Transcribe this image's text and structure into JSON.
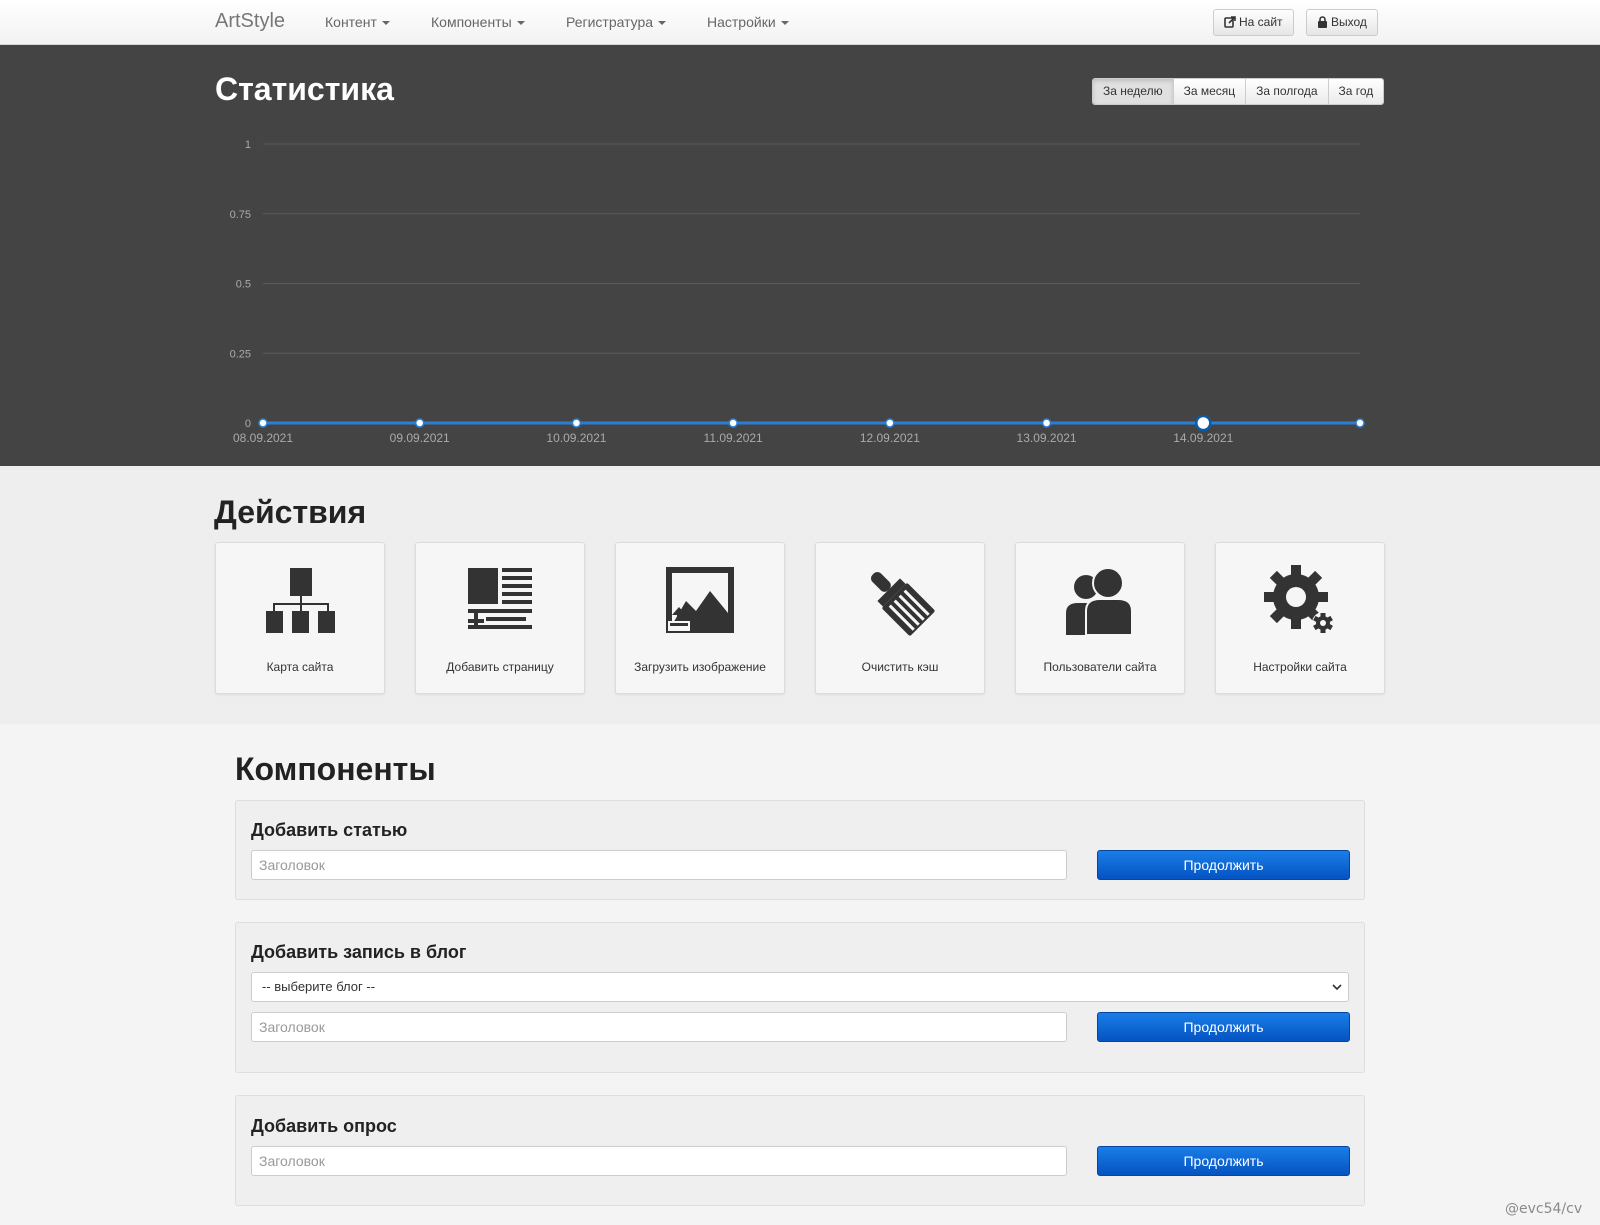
{
  "navbar": {
    "brand": "ArtStyle",
    "menu": [
      {
        "label": "Контент"
      },
      {
        "label": "Компоненты"
      },
      {
        "label": "Регистратура"
      },
      {
        "label": "Настройки"
      }
    ],
    "site_button": {
      "label": "На сайт",
      "icon": "external-link-icon"
    },
    "logout_button": {
      "label": "Выход",
      "icon": "lock-icon"
    }
  },
  "stats": {
    "title": "Статистика",
    "periods": [
      {
        "label": "За неделю",
        "active": true
      },
      {
        "label": "За месяц",
        "active": false
      },
      {
        "label": "За полгода",
        "active": false
      },
      {
        "label": "За год",
        "active": false
      }
    ]
  },
  "chart_data": {
    "type": "line",
    "x": [
      "08.09.2021",
      "09.09.2021",
      "10.09.2021",
      "11.09.2021",
      "12.09.2021",
      "13.09.2021",
      "14.09.2021",
      ""
    ],
    "series": [
      {
        "values": [
          0,
          0,
          0,
          0,
          0,
          0,
          0,
          0
        ]
      }
    ],
    "ylim": [
      0,
      1
    ],
    "yticks": [
      "1",
      "0.75",
      "0.5",
      "0.25",
      "0"
    ],
    "yticks_values": [
      1,
      0.75,
      0.5,
      0.25,
      0
    ],
    "highlighted_index": 6,
    "grid": true,
    "colors": {
      "line": "#2a7fd4",
      "grid": "#5a5a5a",
      "tick": "#aaaaaa",
      "point_fill": "#ffffff"
    }
  },
  "actions": {
    "title": "Действия",
    "items": [
      {
        "label": "Карта сайта",
        "icon": "sitemap-icon"
      },
      {
        "label": "Добавить страницу",
        "icon": "add-page-icon"
      },
      {
        "label": "Загрузить изображение",
        "icon": "upload-image-icon"
      },
      {
        "label": "Очистить кэш",
        "icon": "brush-icon"
      },
      {
        "label": "Пользователи сайта",
        "icon": "users-icon"
      },
      {
        "label": "Настройки сайта",
        "icon": "gear-icon"
      }
    ]
  },
  "components": {
    "title": "Компоненты",
    "article": {
      "title": "Добавить статью",
      "placeholder": "Заголовок",
      "button": "Продолжить"
    },
    "blog": {
      "title": "Добавить запись в блог",
      "select_value": "-- выберите блог --",
      "placeholder": "Заголовок",
      "button": "Продолжить"
    },
    "poll": {
      "title": "Добавить опрос",
      "placeholder": "Заголовок",
      "button": "Продолжить"
    }
  },
  "watermark": "@evc54/cv",
  "colors": {
    "accent": "#0a66d6",
    "dark_band": "#444444",
    "icon": "#333333"
  }
}
